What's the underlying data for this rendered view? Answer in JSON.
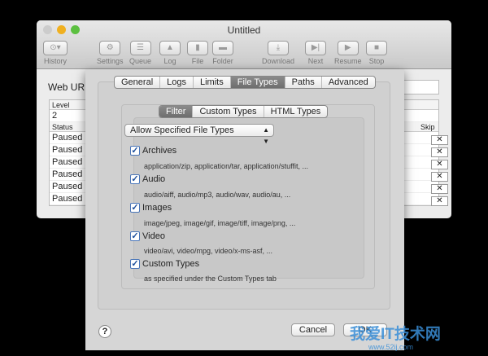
{
  "window": {
    "title": "Untitled"
  },
  "toolbar": [
    {
      "label": "History",
      "icon": "history-icon"
    },
    {
      "label": "Settings",
      "icon": "gear-icon"
    },
    {
      "label": "Queue",
      "icon": "list-icon"
    },
    {
      "label": "Log",
      "icon": "warning-icon"
    },
    {
      "label": "File",
      "icon": "file-icon"
    },
    {
      "label": "Folder",
      "icon": "folder-icon"
    },
    {
      "label": "Download",
      "icon": "download-icon"
    },
    {
      "label": "Next",
      "icon": "next-icon"
    },
    {
      "label": "Resume",
      "icon": "play-icon"
    },
    {
      "label": "Stop",
      "icon": "stop-icon"
    }
  ],
  "main": {
    "web_url_label": "Web URL:",
    "level_header": "Level",
    "level_value": "2",
    "status_header": "Status",
    "skip_header": "Skip",
    "rows": [
      "Paused",
      "Paused",
      "Paused",
      "Paused",
      "Paused",
      "Paused"
    ],
    "skip_glyph": "✕"
  },
  "sheet": {
    "tabs": [
      "General",
      "Logs",
      "Limits",
      "File Types",
      "Paths",
      "Advanced"
    ],
    "subtabs": [
      "Filter",
      "Custom Types",
      "HTML Types"
    ],
    "filter_mode": "Allow Specified File Types",
    "types": [
      {
        "label": "Archives",
        "checked": true,
        "desc": "application/zip, application/tar, application/stuffit, ..."
      },
      {
        "label": "Audio",
        "checked": true,
        "desc": "audio/aiff, audio/mp3, audio/wav, audio/au, ..."
      },
      {
        "label": "Images",
        "checked": true,
        "desc": "image/jpeg, image/gif, image/tiff, image/png, ..."
      },
      {
        "label": "Video",
        "checked": true,
        "desc": "video/avi, video/mpg, video/x-ms-asf, ..."
      },
      {
        "label": "Custom Types",
        "checked": true,
        "desc": "as specified under the Custom Types tab"
      }
    ],
    "help": "?",
    "cancel": "Cancel",
    "ok": "OK"
  },
  "watermark": {
    "title": "我爱IT技术网",
    "url": "www.52ij.com"
  }
}
